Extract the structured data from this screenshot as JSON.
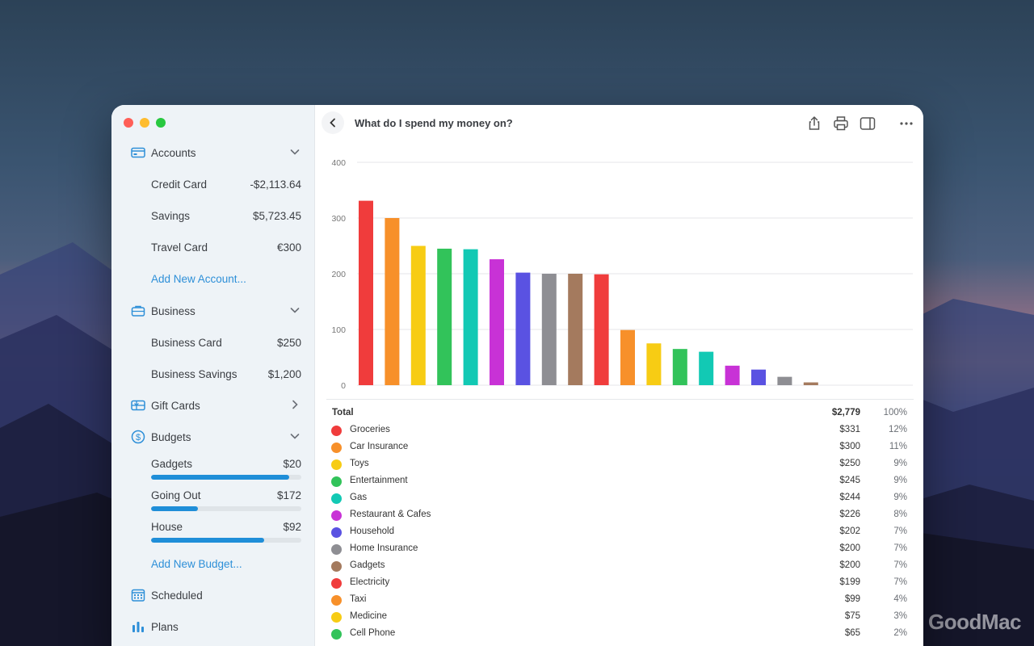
{
  "window_title": "What do I spend my money on?",
  "sidebar": {
    "accounts": {
      "label": "Accounts",
      "items": [
        {
          "label": "Credit Card",
          "value": "-$2,113.64"
        },
        {
          "label": "Savings",
          "value": "$5,723.45"
        },
        {
          "label": "Travel Card",
          "value": "€300"
        }
      ],
      "add_label": "Add New Account..."
    },
    "business": {
      "label": "Business",
      "items": [
        {
          "label": "Business Card",
          "value": "$250"
        },
        {
          "label": "Business Savings",
          "value": "$1,200"
        }
      ]
    },
    "gift_cards": {
      "label": "Gift Cards"
    },
    "budgets": {
      "label": "Budgets",
      "items": [
        {
          "label": "Gadgets",
          "value": "$20",
          "progress": 0.92
        },
        {
          "label": "Going Out",
          "value": "$172",
          "progress": 0.31
        },
        {
          "label": "House",
          "value": "$92",
          "progress": 0.75
        }
      ],
      "add_label": "Add New Budget..."
    },
    "scheduled": {
      "label": "Scheduled"
    },
    "plans": {
      "label": "Plans"
    }
  },
  "legend": {
    "total": {
      "label": "Total",
      "amount": "$2,779",
      "percent": "100%"
    },
    "rows": [
      {
        "label": "Groceries",
        "amount": "$331",
        "percent": "12%",
        "color": "#f03c3c"
      },
      {
        "label": "Car Insurance",
        "amount": "$300",
        "percent": "11%",
        "color": "#f7902a"
      },
      {
        "label": "Toys",
        "amount": "$250",
        "percent": "9%",
        "color": "#f7cc14"
      },
      {
        "label": "Entertainment",
        "amount": "$245",
        "percent": "9%",
        "color": "#32c35a"
      },
      {
        "label": "Gas",
        "amount": "$244",
        "percent": "9%",
        "color": "#12c9b4"
      },
      {
        "label": "Restaurant & Cafes",
        "amount": "$226",
        "percent": "8%",
        "color": "#c832d6"
      },
      {
        "label": "Household",
        "amount": "$202",
        "percent": "7%",
        "color": "#5a52e2"
      },
      {
        "label": "Home Insurance",
        "amount": "$200",
        "percent": "7%",
        "color": "#8e8e93"
      },
      {
        "label": "Gadgets",
        "amount": "$200",
        "percent": "7%",
        "color": "#a47a5e"
      },
      {
        "label": "Electricity",
        "amount": "$199",
        "percent": "7%",
        "color": "#f03c3c"
      },
      {
        "label": "Taxi",
        "amount": "$99",
        "percent": "4%",
        "color": "#f7902a"
      },
      {
        "label": "Medicine",
        "amount": "$75",
        "percent": "3%",
        "color": "#f7cc14"
      },
      {
        "label": "Cell Phone",
        "amount": "$65",
        "percent": "2%",
        "color": "#32c35a"
      }
    ]
  },
  "chart_data": {
    "type": "bar",
    "title": "",
    "xlabel": "",
    "ylabel": "",
    "ylim": [
      0,
      400
    ],
    "yticks": [
      0,
      100,
      200,
      300,
      400
    ],
    "grid": true,
    "values": [
      331,
      300,
      250,
      245,
      244,
      226,
      202,
      200,
      200,
      199,
      99,
      75,
      65,
      60,
      35,
      28,
      15,
      5
    ],
    "colors": [
      "#f03c3c",
      "#f7902a",
      "#f7cc14",
      "#32c35a",
      "#12c9b4",
      "#c832d6",
      "#5a52e2",
      "#8e8e93",
      "#a47a5e",
      "#f03c3c",
      "#f7902a",
      "#f7cc14",
      "#32c35a",
      "#12c9b4",
      "#c832d6",
      "#5a52e2",
      "#8e8e93",
      "#a47a5e"
    ]
  },
  "watermark": "GoodMac"
}
